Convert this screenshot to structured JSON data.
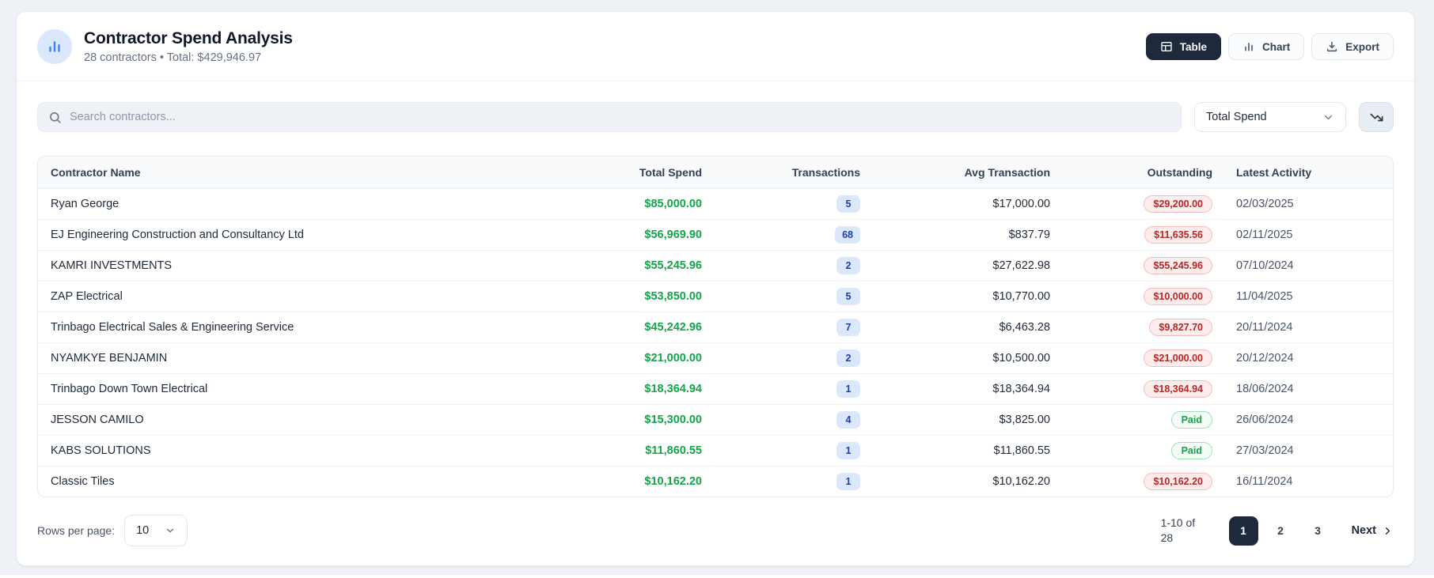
{
  "header": {
    "title": "Contractor Spend Analysis",
    "subtitle": "28 contractors • Total: $429,946.97",
    "actions": {
      "table_label": "Table",
      "chart_label": "Chart",
      "export_label": "Export"
    }
  },
  "toolbar": {
    "search_placeholder": "Search contractors...",
    "sort_by_value": "Total Spend"
  },
  "table": {
    "columns": [
      "Contractor Name",
      "Total Spend",
      "Transactions",
      "Avg Transaction",
      "Outstanding",
      "Latest Activity"
    ],
    "rows": [
      {
        "name": "Ryan George",
        "total_spend": "$85,000.00",
        "transactions": "5",
        "avg_transaction": "$17,000.00",
        "outstanding": "$29,200.00",
        "outstanding_status": "due",
        "latest_activity": "02/03/2025"
      },
      {
        "name": "EJ Engineering Construction and Consultancy Ltd",
        "total_spend": "$56,969.90",
        "transactions": "68",
        "avg_transaction": "$837.79",
        "outstanding": "$11,635.56",
        "outstanding_status": "due",
        "latest_activity": "02/11/2025"
      },
      {
        "name": "KAMRI INVESTMENTS",
        "total_spend": "$55,245.96",
        "transactions": "2",
        "avg_transaction": "$27,622.98",
        "outstanding": "$55,245.96",
        "outstanding_status": "due",
        "latest_activity": "07/10/2024"
      },
      {
        "name": "ZAP Electrical",
        "total_spend": "$53,850.00",
        "transactions": "5",
        "avg_transaction": "$10,770.00",
        "outstanding": "$10,000.00",
        "outstanding_status": "due",
        "latest_activity": "11/04/2025"
      },
      {
        "name": "Trinbago Electrical Sales & Engineering Service",
        "total_spend": "$45,242.96",
        "transactions": "7",
        "avg_transaction": "$6,463.28",
        "outstanding": "$9,827.70",
        "outstanding_status": "due",
        "latest_activity": "20/11/2024"
      },
      {
        "name": "NYAMKYE BENJAMIN",
        "total_spend": "$21,000.00",
        "transactions": "2",
        "avg_transaction": "$10,500.00",
        "outstanding": "$21,000.00",
        "outstanding_status": "due",
        "latest_activity": "20/12/2024"
      },
      {
        "name": "Trinbago Down Town Electrical",
        "total_spend": "$18,364.94",
        "transactions": "1",
        "avg_transaction": "$18,364.94",
        "outstanding": "$18,364.94",
        "outstanding_status": "due",
        "latest_activity": "18/06/2024"
      },
      {
        "name": "JESSON CAMILO",
        "total_spend": "$15,300.00",
        "transactions": "4",
        "avg_transaction": "$3,825.00",
        "outstanding": "Paid",
        "outstanding_status": "paid",
        "latest_activity": "26/06/2024"
      },
      {
        "name": "KABS SOLUTIONS",
        "total_spend": "$11,860.55",
        "transactions": "1",
        "avg_transaction": "$11,860.55",
        "outstanding": "Paid",
        "outstanding_status": "paid",
        "latest_activity": "27/03/2024"
      },
      {
        "name": "Classic Tiles",
        "total_spend": "$10,162.20",
        "transactions": "1",
        "avg_transaction": "$10,162.20",
        "outstanding": "$10,162.20",
        "outstanding_status": "due",
        "latest_activity": "16/11/2024"
      }
    ]
  },
  "footer": {
    "rows_per_page_label": "Rows per page:",
    "rows_per_page_value": "10",
    "range_text": "1-10 of 28",
    "pages": [
      "1",
      "2",
      "3"
    ],
    "active_page": "1",
    "next_label": "Next"
  },
  "colors": {
    "accent_navy": "#1e293b",
    "money_green": "#16a34a",
    "count_badge_bg": "#dbe7fb",
    "count_badge_text": "#1e40af",
    "due_badge_bg": "#fdecec",
    "due_badge_text": "#b92626",
    "paid_badge_text": "#16a34a",
    "icon_blue": "#3b82f6"
  }
}
